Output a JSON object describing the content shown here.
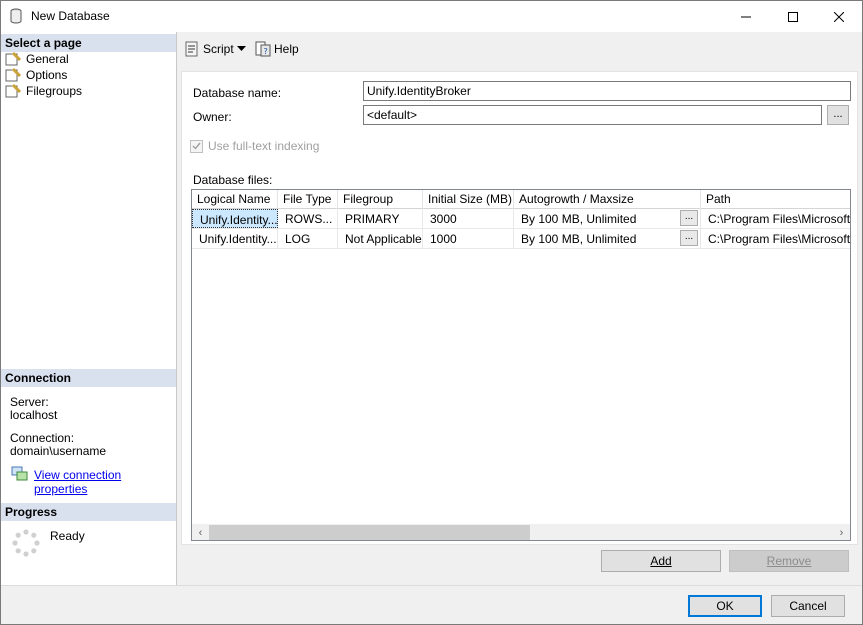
{
  "window": {
    "title": "New Database"
  },
  "sidebar": {
    "select_page_header": "Select a page",
    "pages": [
      {
        "label": "General"
      },
      {
        "label": "Options"
      },
      {
        "label": "Filegroups"
      }
    ],
    "connection_header": "Connection",
    "server_label": "Server:",
    "server_value": "localhost",
    "connection_label": "Connection:",
    "connection_value": "domain\\username",
    "view_connection_link": "View connection properties",
    "progress_header": "Progress",
    "progress_status": "Ready"
  },
  "toolbar": {
    "script_label": "Script",
    "help_label": "Help"
  },
  "form": {
    "database_name_label": "Database name:",
    "database_name_value": "Unify.IdentityBroker",
    "owner_label": "Owner:",
    "owner_value": "<default>",
    "owner_browse": "...",
    "fulltext_label": "Use full-text indexing",
    "database_files_label": "Database files:"
  },
  "grid": {
    "columns": [
      "Logical Name",
      "File Type",
      "Filegroup",
      "Initial Size (MB)",
      "Autogrowth / Maxsize",
      "Path"
    ],
    "rows": [
      {
        "logical_name": "Unify.Identity...",
        "file_type": "ROWS...",
        "filegroup": "PRIMARY",
        "initial_size": "3000",
        "autogrowth": "By 100 MB, Unlimited",
        "autogrowth_btn": "...",
        "path": "C:\\Program Files\\Microsoft SQ"
      },
      {
        "logical_name": "Unify.Identity...",
        "file_type": "LOG",
        "filegroup": "Not Applicable",
        "initial_size": "1000",
        "autogrowth": "By 100 MB, Unlimited",
        "autogrowth_btn": "...",
        "path": "C:\\Program Files\\Microsoft SQ"
      }
    ]
  },
  "buttons": {
    "add": "Add",
    "remove": "Remove",
    "ok": "OK",
    "cancel": "Cancel"
  },
  "colors": {
    "section_header_bg": "#d9e1ef",
    "link": "#0000ee",
    "selected_cell": "#cce8ff",
    "default_button_border": "#0078d7"
  }
}
